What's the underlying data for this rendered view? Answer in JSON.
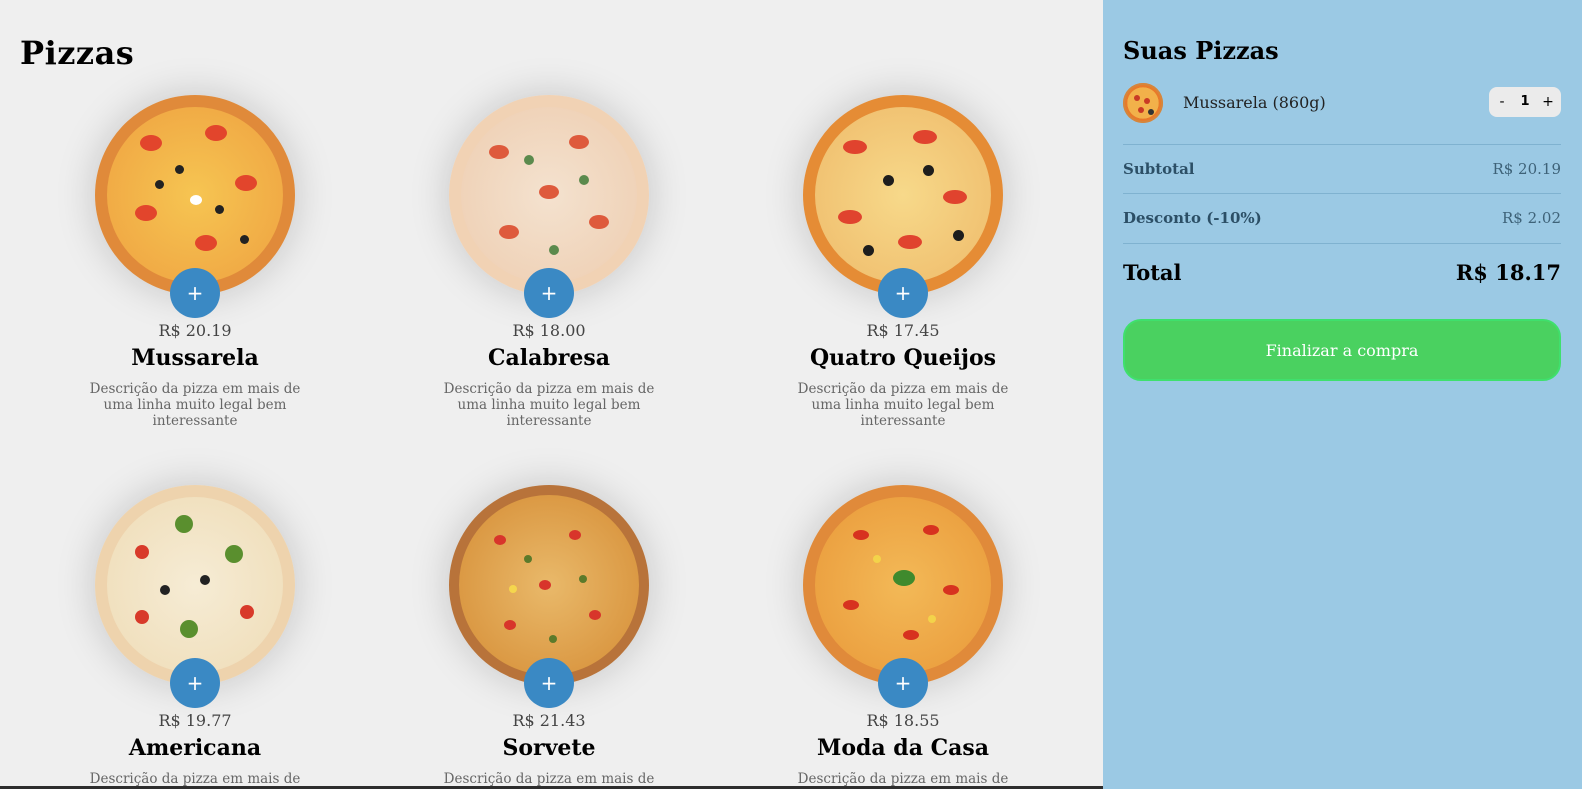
{
  "main": {
    "title": "Pizzas",
    "pizzas": [
      {
        "price": "R$ 20.19",
        "name": "Mussarela",
        "description": "Descrição da pizza em mais de uma linha muito legal bem interessante",
        "add_label": "+"
      },
      {
        "price": "R$ 18.00",
        "name": "Calabresa",
        "description": "Descrição da pizza em mais de uma linha muito legal bem interessante",
        "add_label": "+"
      },
      {
        "price": "R$ 17.45",
        "name": "Quatro Queijos",
        "description": "Descrição da pizza em mais de uma linha muito legal bem interessante",
        "add_label": "+"
      },
      {
        "price": "R$ 19.77",
        "name": "Americana",
        "description": "Descrição da pizza em mais de uma linha muito legal bem interessante",
        "add_label": "+"
      },
      {
        "price": "R$ 21.43",
        "name": "Sorvete",
        "description": "Descrição da pizza em mais de uma linha muito legal bem interessante",
        "add_label": "+"
      },
      {
        "price": "R$ 18.55",
        "name": "Moda da Casa",
        "description": "Descrição da pizza em mais de uma linha muito legal bem interessante",
        "add_label": "+"
      }
    ]
  },
  "cart": {
    "title": "Suas Pizzas",
    "items": [
      {
        "name": "Mussarela (860g)",
        "quantity": "1",
        "minus_label": "-",
        "plus_label": "+"
      }
    ],
    "subtotal_label": "Subtotal",
    "subtotal_value": "R$ 20.19",
    "discount_label": "Desconto (-10%)",
    "discount_value": "R$ 2.02",
    "total_label": "Total",
    "total_value": "R$ 18.17",
    "checkout_label": "Finalizar a compra"
  },
  "colors": {
    "accent_blue": "#3a89c4",
    "sidebar_bg": "#9bc9e4",
    "checkout_green": "#4ad160",
    "page_bg": "#efefef"
  },
  "icons": {
    "add": "plus-icon"
  }
}
